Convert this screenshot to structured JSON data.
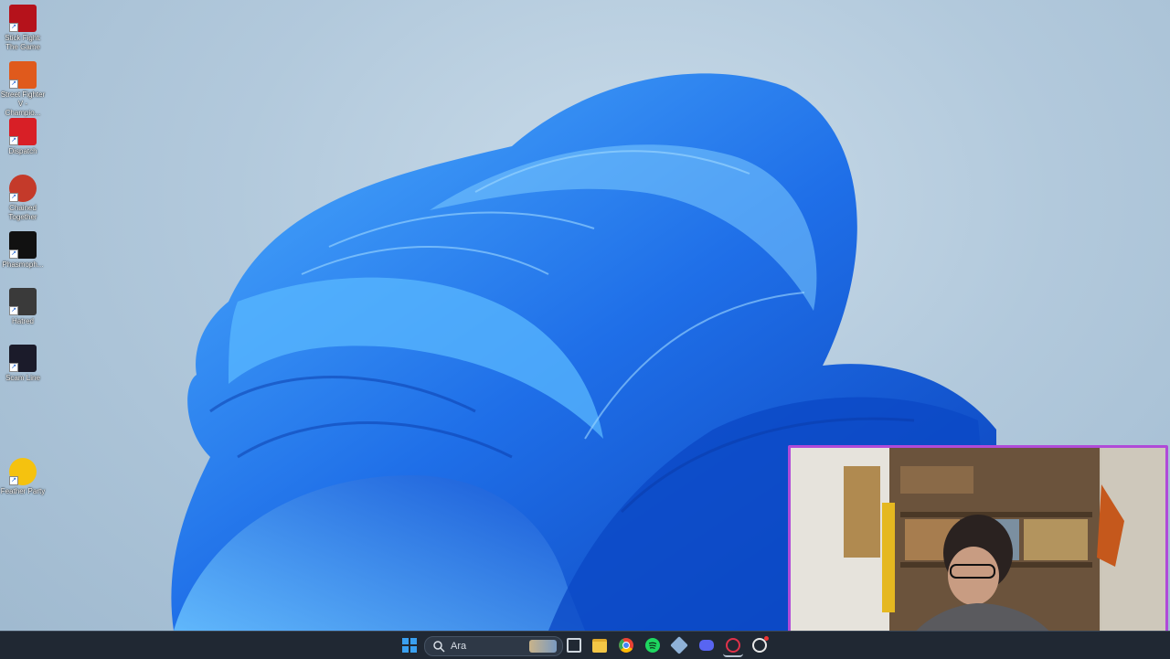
{
  "desktop_icons": [
    {
      "label": "Stick Fight: The Game",
      "icon": "stick-fight-icon",
      "color": "#b5121b"
    },
    {
      "label": "Street Fighter V - Champio...",
      "icon": "street-fighter-icon",
      "color": "#e05a1c"
    },
    {
      "label": "Dispatch",
      "icon": "dispatch-icon",
      "color": "#d81f26"
    },
    {
      "label": "Chained Together",
      "icon": "chained-together-icon",
      "color": "#c43a2a"
    },
    {
      "label": "Phasmoph...",
      "icon": "phasmophobia-icon",
      "color": "#111111"
    },
    {
      "label": "Hatred",
      "icon": "hatred-icon",
      "color": "#3a3a3a"
    },
    {
      "label": "Scam Line",
      "icon": "scam-line-icon",
      "color": "#1b1b2a"
    },
    {
      "label": "Feather Party",
      "icon": "feather-party-icon",
      "color": "#f5c20f"
    }
  ],
  "taskbar": {
    "search_value": "Ara",
    "apps": [
      {
        "name": "start-icon",
        "color": "#3aa0f0"
      },
      {
        "name": "task-view-icon",
        "color": "#cfd6de"
      },
      {
        "name": "file-explorer-icon",
        "color": "#f3c646"
      },
      {
        "name": "chrome-icon",
        "color": "#e94235"
      },
      {
        "name": "spotify-icon",
        "color": "#1ed760"
      },
      {
        "name": "app-icon",
        "color": "#8fb2d8"
      },
      {
        "name": "discord-icon",
        "color": "#5865f2"
      },
      {
        "name": "recording-app-icon",
        "color": "#e0324a"
      },
      {
        "name": "app-badge-icon",
        "color": "#e8e8e8"
      }
    ]
  },
  "colors": {
    "bloom_blue": "#1e6ee8",
    "webcam_border": "#b04ad8",
    "taskbar_bg": "#202833"
  }
}
